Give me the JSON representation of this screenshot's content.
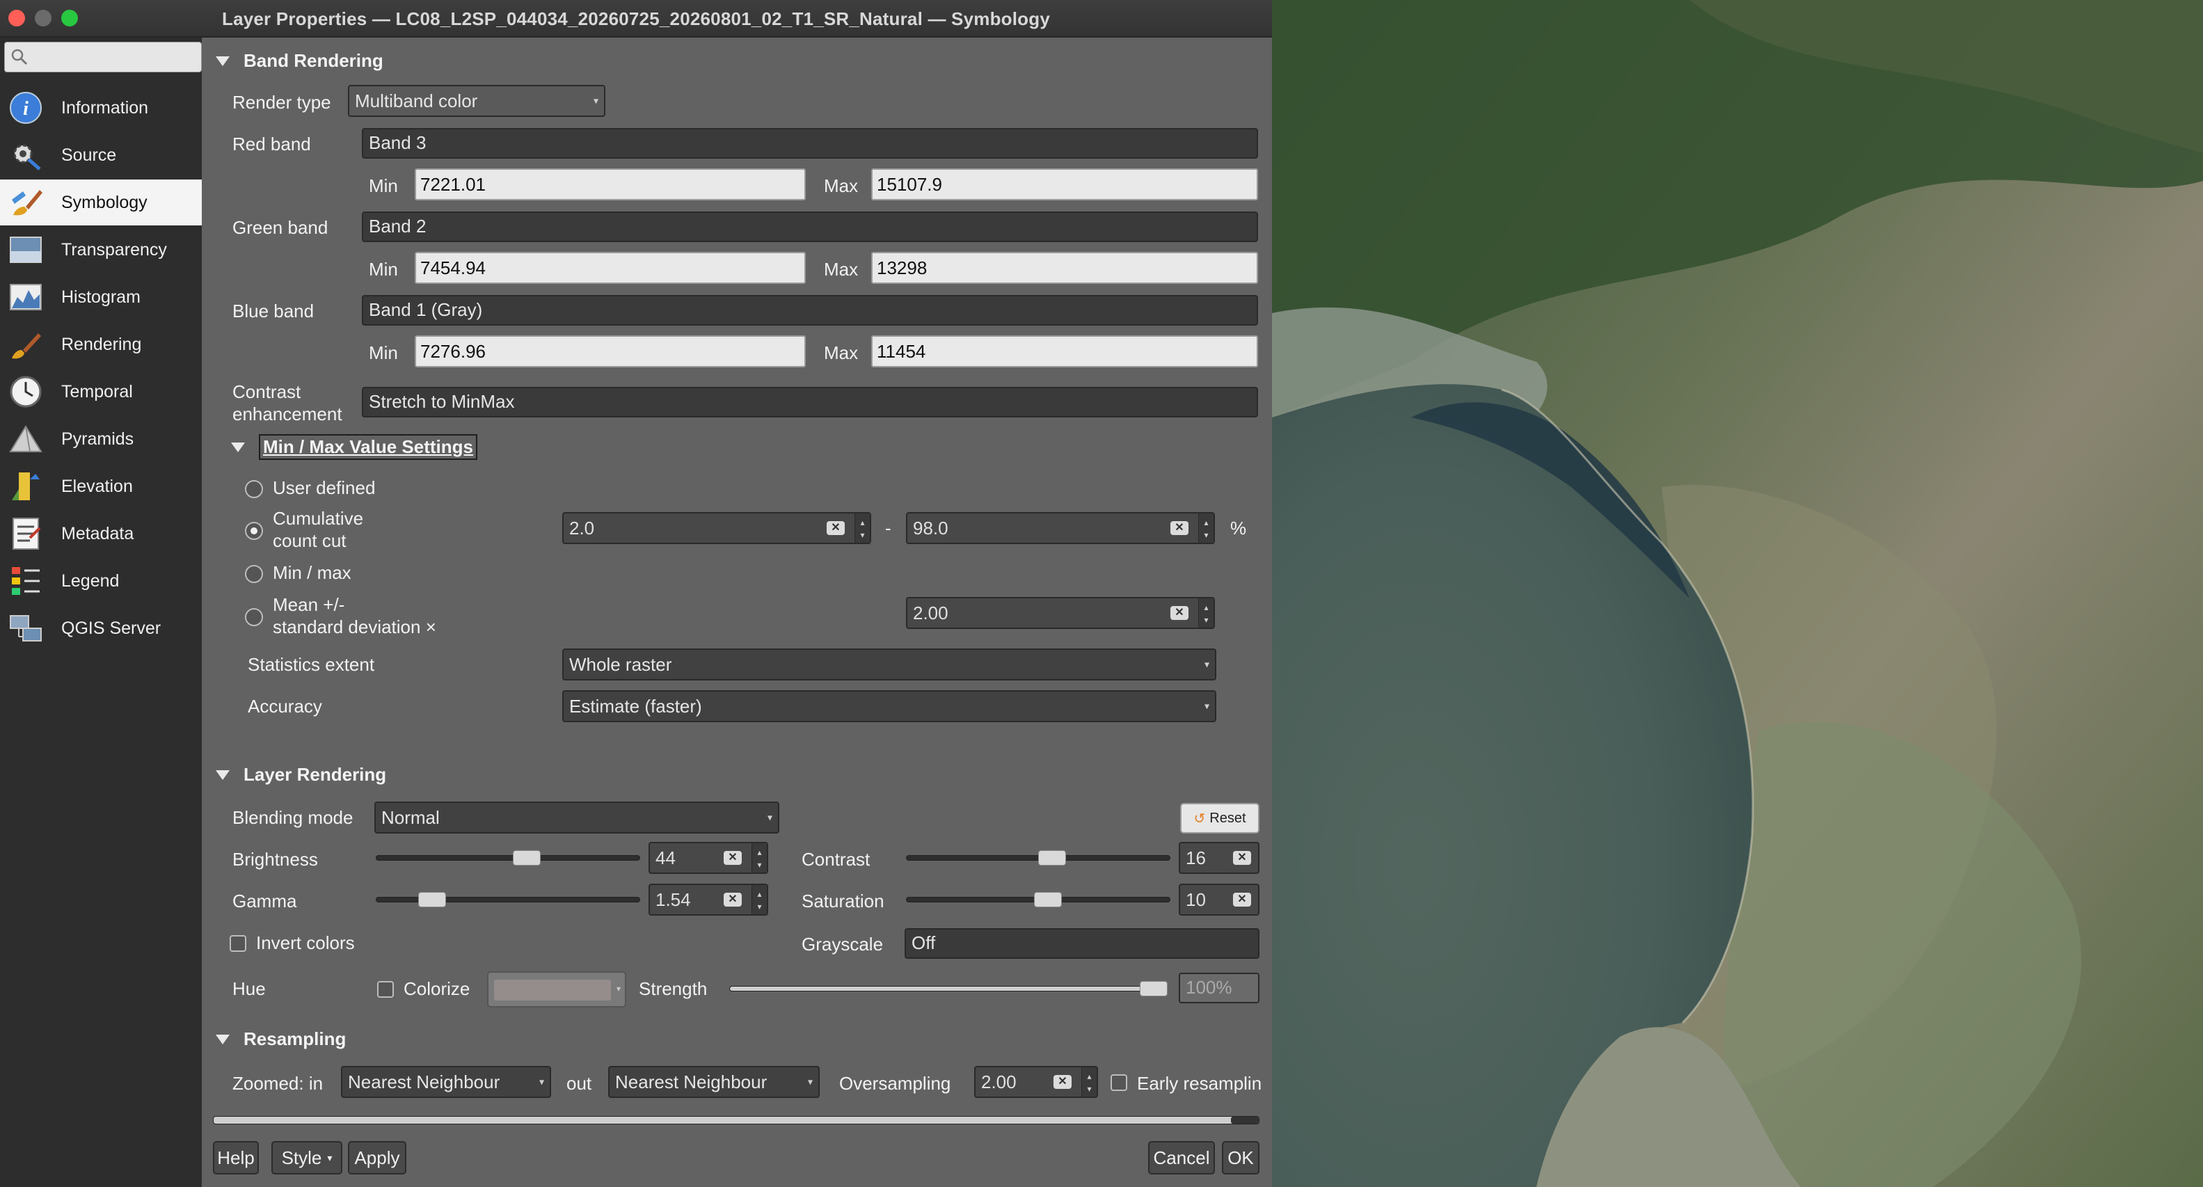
{
  "window": {
    "title": "Layer Properties — LC08_L2SP_044034_20260725_20260801_02_T1_SR_Natural — Symbology"
  },
  "sidebar": {
    "items": [
      {
        "label": "Information"
      },
      {
        "label": "Source"
      },
      {
        "label": "Symbology"
      },
      {
        "label": "Transparency"
      },
      {
        "label": "Histogram"
      },
      {
        "label": "Rendering"
      },
      {
        "label": "Temporal"
      },
      {
        "label": "Pyramids"
      },
      {
        "label": "Elevation"
      },
      {
        "label": "Metadata"
      },
      {
        "label": "Legend"
      },
      {
        "label": "QGIS Server"
      }
    ],
    "active": "Symbology"
  },
  "band_rendering": {
    "header": "Band Rendering",
    "render_type_label": "Render type",
    "render_type": "Multiband color",
    "red_label": "Red band",
    "red_band": "Band 3",
    "red_min": "7221.01",
    "red_max": "15107.9",
    "green_label": "Green band",
    "green_band": "Band 2",
    "green_min": "7454.94",
    "green_max": "13298",
    "blue_label": "Blue band",
    "blue_band": "Band 1 (Gray)",
    "blue_min": "7276.96",
    "blue_max": "11454",
    "min_label": "Min",
    "max_label": "Max",
    "contrast_label_1": "Contrast",
    "contrast_label_2": "enhancement",
    "contrast": "Stretch to MinMax"
  },
  "minmax": {
    "header": "Min / Max Value Settings",
    "user_defined": "User defined",
    "cumulative_1": "Cumulative",
    "cumulative_2": "count cut",
    "cum_low": "2.0",
    "dash": "-",
    "cum_high": "98.0",
    "percent": "%",
    "minmax_opt": "Min / max",
    "mean_1": "Mean +/-",
    "mean_2": "standard deviation ×",
    "stddev": "2.00",
    "stats_extent_label": "Statistics extent",
    "stats_extent": "Whole raster",
    "accuracy_label": "Accuracy",
    "accuracy": "Estimate (faster)"
  },
  "layer_rendering": {
    "header": "Layer Rendering",
    "blending_label": "Blending mode",
    "blending": "Normal",
    "reset": "Reset",
    "brightness_label": "Brightness",
    "brightness": "44",
    "brightness_level": 0.58,
    "contrast_label": "Contrast",
    "contrast": "16",
    "contrast_level": 0.56,
    "gamma_label": "Gamma",
    "gamma": "1.54",
    "gamma_level": 0.18,
    "saturation_label": "Saturation",
    "saturation": "10",
    "saturation_level": 0.54,
    "invert_label": "Invert colors",
    "grayscale_label": "Grayscale",
    "grayscale": "Off",
    "hue_label": "Hue",
    "colorize_label": "Colorize",
    "strength_label": "Strength",
    "strength": "100%",
    "strength_level": 1.0
  },
  "resampling": {
    "header": "Resampling",
    "zoomed_in_label": "Zoomed: in",
    "zoomed_in": "Nearest Neighbour",
    "out_label": "out",
    "zoomed_out": "Nearest Neighbour",
    "oversampling_label": "Oversampling",
    "oversampling": "2.00",
    "early_label": "Early resamplin"
  },
  "buttons": {
    "help": "Help",
    "style": "Style",
    "apply": "Apply",
    "cancel": "Cancel",
    "ok": "OK"
  },
  "icons": {
    "information": "info-icon",
    "source": "source-gear-icon",
    "symbology": "paintbrush-icon",
    "transparency": "transparency-icon",
    "histogram": "histogram-icon",
    "rendering": "rendering-brush-icon",
    "temporal": "clock-icon",
    "pyramids": "pyramid-icon",
    "elevation": "elevation-icon",
    "metadata": "metadata-icon",
    "legend": "legend-icon",
    "qgis_server": "server-icon"
  },
  "colors": {
    "close": "#ff5f57",
    "minimize": "#febc2e",
    "zoom": "#28c840",
    "active_item_bg": "#f4f4f4"
  }
}
